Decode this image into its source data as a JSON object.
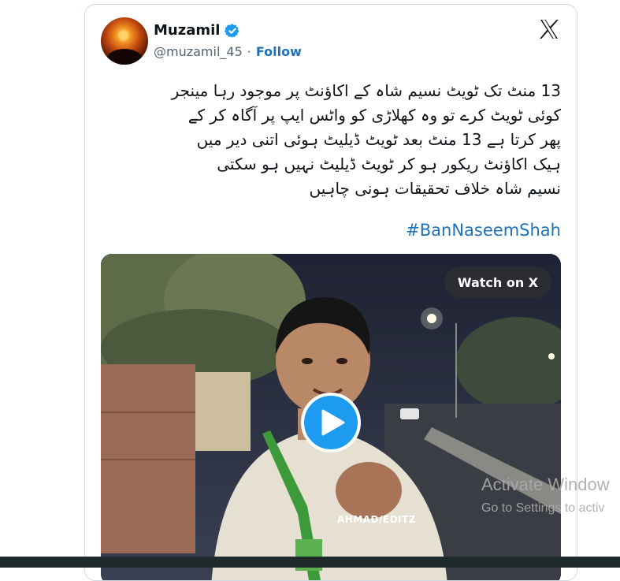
{
  "tweet": {
    "author_name": "Muzamil",
    "handle": "@muzamil_45",
    "separator": "·",
    "follow_label": "Follow",
    "text_lines": [
      "13 منٹ تک ٹویٹ نسیم شاہ کے اکاؤنٹ پر موجود رہا مینجر",
      "کوئی ٹویٹ کرے تو وہ کھلاڑی کو واٹس ایپ پر آگاہ کر کے",
      "پھر کرتا ہے 13 منٹ بعد ٹویٹ ڈیلیٹ ہوئی اتنی دیر میں",
      "ہیک اکاؤنٹ ریکور ہو کر ٹویٹ ڈیلیٹ نہیں ہو سکتی",
      "نسیم شاہ خلاف تحقیقات ہونی چاہیں"
    ],
    "hashtag": "#BanNaseemShah",
    "media": {
      "watch_label": "Watch on X",
      "badge_text": "AHMAD/EDITZ"
    }
  },
  "icons": {
    "verified": "verified-badge-icon",
    "x_logo": "x-logo-icon",
    "play": "play-icon"
  },
  "os_overlay": {
    "activate_title": "Activate Window",
    "activate_sub": "Go to Settings to activ"
  },
  "colors": {
    "link": "#1d72b8",
    "verified": "#1d9bf0",
    "play_button": "#1d9bf0",
    "text": "#0f1419",
    "muted": "#536471"
  }
}
